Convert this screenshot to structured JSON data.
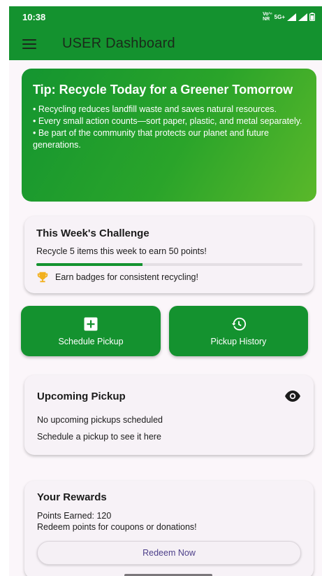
{
  "status_bar": {
    "time": "10:38",
    "network_top": "Vo¹ⁿ",
    "network_bottom": "NR",
    "signal_label": "5G+"
  },
  "app_bar": {
    "title": "USER Dashboard",
    "menu_icon": "hamburger-menu-icon"
  },
  "tip": {
    "title": "Tip: Recycle Today for a Greener Tomorrow",
    "lines": [
      "• Recycling reduces landfill waste and saves natural resources.",
      "• Every small action counts—sort paper, plastic, and metal separately.",
      "• Be part of the community that protects our planet and future generations."
    ]
  },
  "challenge": {
    "title": "This Week's Challenge",
    "description": "Recycle 5 items this week to earn 50 points!",
    "progress": 0.4,
    "badge_text": "Earn badges for consistent recycling!",
    "badge_icon": "trophy-icon"
  },
  "actions": {
    "schedule_label": "Schedule Pickup",
    "schedule_icon": "add-box-icon",
    "history_label": "Pickup History",
    "history_icon": "history-icon"
  },
  "upcoming": {
    "title": "Upcoming Pickup",
    "status": "No upcoming pickups scheduled",
    "hint": "Schedule a pickup to see it here",
    "icon": "eye-icon"
  },
  "rewards": {
    "title": "Your Rewards",
    "points": "Points Earned: 120",
    "description": "Redeem points for coupons or donations!",
    "button_label": "Redeem Now"
  },
  "colors": {
    "primary": "#14922f",
    "card_bg": "#f7f2f7",
    "redeem_text": "#4d3f8a",
    "trophy": "#f2b01e"
  }
}
